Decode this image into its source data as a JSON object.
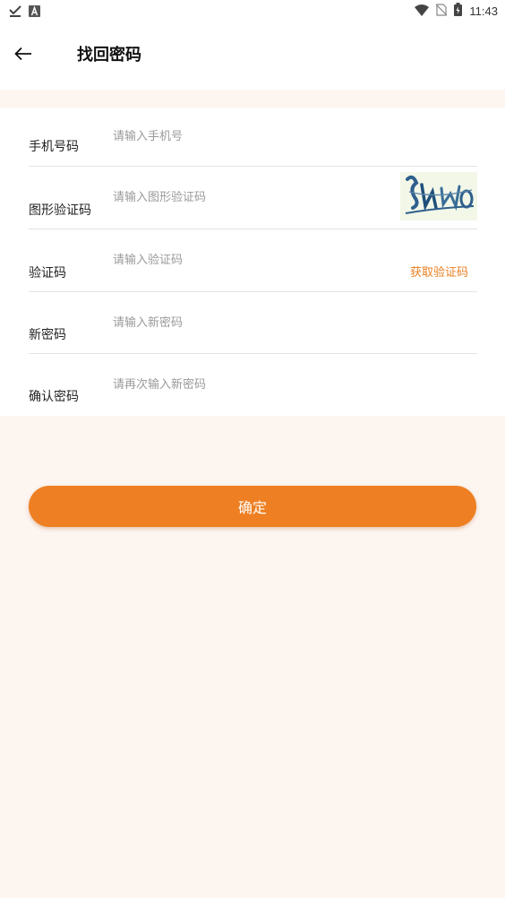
{
  "status_bar": {
    "time": "11:43",
    "left_icons": [
      "check-download-icon",
      "a-box-icon"
    ],
    "right_icons": [
      "wifi-icon",
      "no-sim-icon",
      "battery-charging-icon"
    ]
  },
  "header": {
    "back_icon": "arrow-left-icon",
    "title": "找回密码"
  },
  "form": {
    "phone": {
      "label": "手机号码",
      "placeholder": "请输入手机号",
      "value": ""
    },
    "image_captcha": {
      "label": "图形验证码",
      "placeholder": "请输入图形验证码",
      "value": "",
      "captcha_text": "FUWQ"
    },
    "sms_code": {
      "label": "验证码",
      "placeholder": "请输入验证码",
      "value": "",
      "get_code_label": "获取验证码"
    },
    "new_password": {
      "label": "新密码",
      "placeholder": "请输入新密码",
      "value": ""
    },
    "confirm_password": {
      "label": "确认密码",
      "placeholder": "请再次输入新密码",
      "value": ""
    }
  },
  "confirm_button": {
    "label": "确定"
  },
  "colors": {
    "accent": "#ee7f22",
    "link": "#e98022",
    "page_background": "#fdf5f0",
    "card_background": "#ffffff",
    "divider": "#e2e2e2"
  }
}
